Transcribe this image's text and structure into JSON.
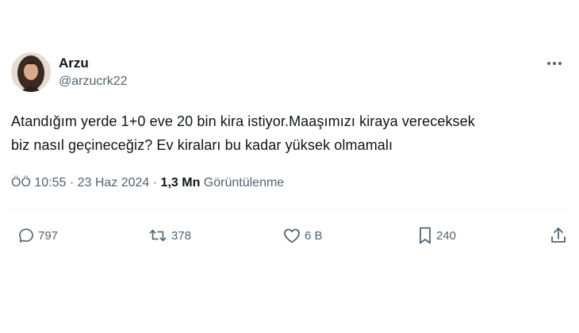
{
  "author": {
    "display_name": "Arzu",
    "handle": "@arzucrk22"
  },
  "tweet": {
    "line1": "Atandığım yerde 1+0 eve 20 bin kira istiyor.Maaşımızı kiraya vereceksek",
    "line2": "biz nasıl geçineceğiz? Ev kiraları bu kadar yüksek olmamalı"
  },
  "meta": {
    "time": "ÖÖ 10:55",
    "separator": " · ",
    "date": "23 Haz 2024",
    "views_count": "1,3 Mn",
    "views_label": "Görüntülenme"
  },
  "actions": {
    "replies": "797",
    "reposts": "378",
    "likes": "6 B",
    "bookmarks": "240"
  },
  "icons": [
    "more-icon",
    "reply-icon",
    "repost-icon",
    "like-icon",
    "bookmark-icon",
    "share-icon"
  ],
  "colors": {
    "text": "#0f1419",
    "secondary": "#536471",
    "divider": "#eff3f4"
  }
}
